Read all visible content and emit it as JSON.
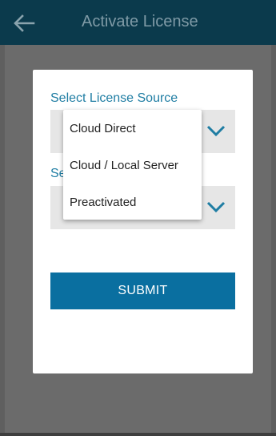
{
  "header": {
    "title": "Activate License",
    "back_icon": "arrow-left-icon"
  },
  "dialog": {
    "license_source_label": "Select License Source",
    "second_label": "Se",
    "submit_label": "SUBMIT",
    "chevron_icon": "chevron-down-icon"
  },
  "dropdown": {
    "options": [
      "Cloud Direct",
      "Cloud / Local Server",
      "Preactivated"
    ]
  },
  "colors": {
    "app_bar": "#0b3a4c",
    "accent": "#1f7da3",
    "submit": "#0a6fa0",
    "scrim": "#6b6b6b"
  }
}
